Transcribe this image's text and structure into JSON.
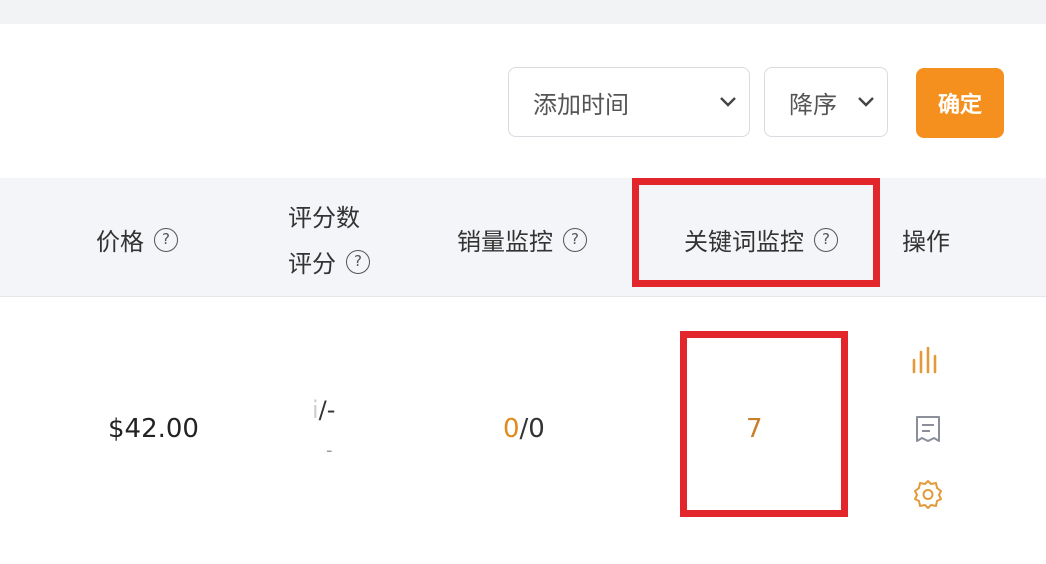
{
  "sort_bar": {
    "field_select": {
      "value": "添加时间"
    },
    "order_select": {
      "value": "降序"
    },
    "confirm_label": "确定"
  },
  "table": {
    "headers": {
      "price": "价格",
      "rating_line1": "评分数",
      "rating_line2": "评分",
      "sales_monitor": "销量监控",
      "keyword_monitor": "关键词监控",
      "actions": "操作",
      "help_glyph": "?"
    },
    "rows": [
      {
        "price": "$42.00",
        "rating_prefix": "i",
        "rating_count": "/-",
        "rating_score": "-",
        "sales_current": "0",
        "sales_total": "/0",
        "keyword_count": "7"
      }
    ],
    "action_icons": [
      "bar-chart-icon",
      "note-icon",
      "gear-icon"
    ]
  },
  "colors": {
    "accent": "#f5901e",
    "highlight": "#e2262b",
    "header_bg": "#f4f5f8",
    "value_orange": "#c9802a"
  }
}
